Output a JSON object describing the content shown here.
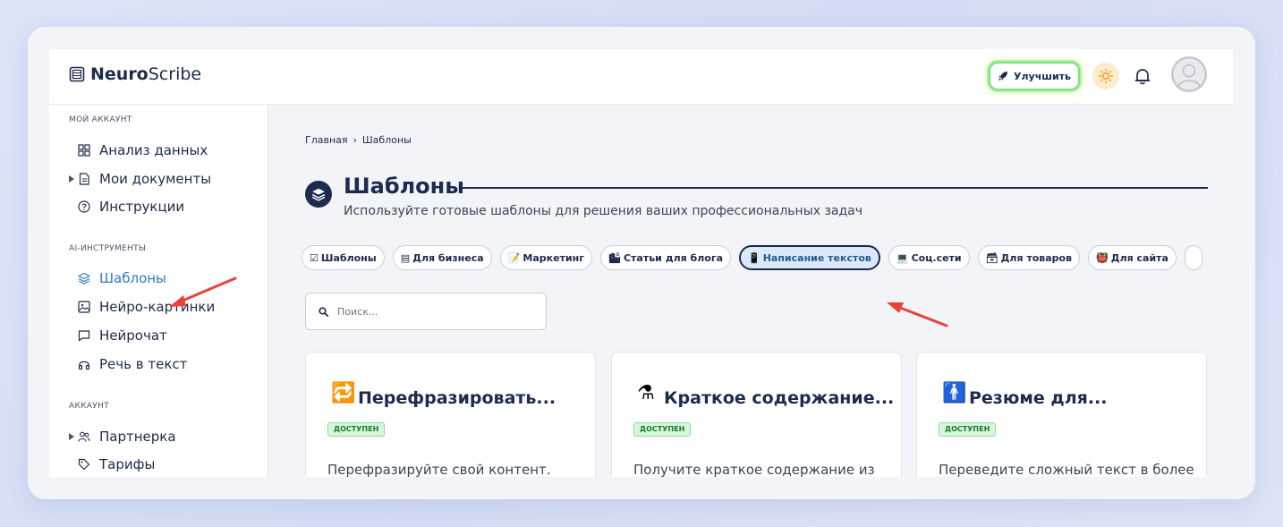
{
  "header": {
    "logo_bold": "Neuro",
    "logo_light": "Scribe",
    "upgrade_label": "Улучшить"
  },
  "sidebar": {
    "section_account": "МОЙ АККАУНТ",
    "section_ai": "AI-ИНСТРУМЕНТЫ",
    "section_acc2": "АККАУНТ",
    "items": [
      {
        "label": "Анализ данных"
      },
      {
        "label": "Мои документы"
      },
      {
        "label": "Инструкции"
      },
      {
        "label": "Шаблоны"
      },
      {
        "label": "Нейро-картинки"
      },
      {
        "label": "Нейрочат"
      },
      {
        "label": "Речь в текст"
      },
      {
        "label": "Партнерка"
      },
      {
        "label": "Тарифы"
      }
    ],
    "active_item": "Шаблоны"
  },
  "main": {
    "breadcrumb_home": "Главная",
    "breadcrumb_sep": "›",
    "breadcrumb_current": "Шаблоны",
    "title": "Шаблоны",
    "subtitle": "Используйте готовые шаблоны для решения ваших профессиональных задач",
    "chips": [
      {
        "icon": "☑",
        "label": "Шаблоны"
      },
      {
        "icon": "▤",
        "label": "Для бизнеса"
      },
      {
        "icon": "📝",
        "label": "Маркетинг"
      },
      {
        "icon": "🏙",
        "label": "Статьи для блога"
      },
      {
        "icon": "📱",
        "label": "Написание текстов"
      },
      {
        "icon": "💻",
        "label": "Соц.сети"
      },
      {
        "icon": "🗃",
        "label": "Для товаров"
      },
      {
        "icon": "👹",
        "label": "Для сайта"
      }
    ],
    "active_chip": "Написание текстов",
    "search_placeholder": "Поиск...",
    "cards": [
      {
        "icon": "🔁",
        "title": "Перефразировать...",
        "badge": "ДОСТУПЕН",
        "desc": "Перефразируйте свой контент."
      },
      {
        "icon": "⚗",
        "title": "Краткое содержание...",
        "badge": "ДОСТУПЕН",
        "desc": "Получите краткое содержание из"
      },
      {
        "icon": "🚹",
        "title": "Резюме для...",
        "badge": "ДОСТУПЕН",
        "desc": "Переведите сложный текст в более"
      }
    ]
  },
  "colors": {
    "accent": "#2f7bbd",
    "dark_navy": "#1c2b4e",
    "annotation_arrow": "#e8433a"
  }
}
